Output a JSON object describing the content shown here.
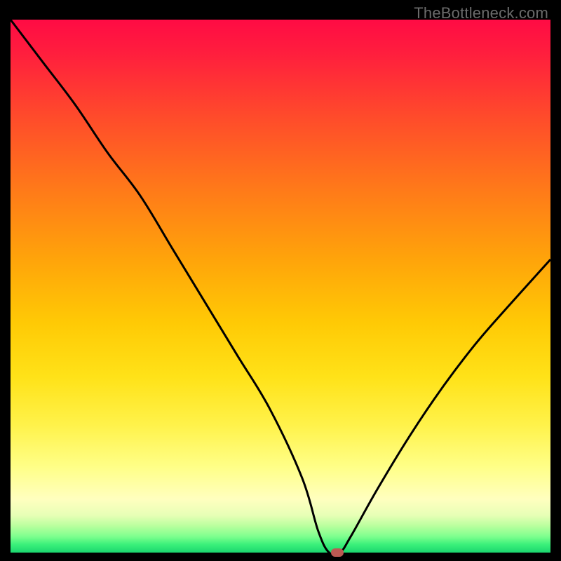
{
  "watermark": "TheBottleneck.com",
  "colors": {
    "curve_stroke": "#000000",
    "marker_fill": "#bc5a53"
  },
  "chart_data": {
    "type": "line",
    "title": "",
    "xlabel": "",
    "ylabel": "",
    "xlim": [
      0,
      100
    ],
    "ylim": [
      0,
      100
    ],
    "grid": false,
    "legend": false,
    "annotations": [
      {
        "kind": "marker",
        "x": 60.5,
        "y": 0,
        "shape": "pill"
      }
    ],
    "series": [
      {
        "name": "bottleneck-curve",
        "x": [
          0,
          6,
          12,
          18,
          24,
          30,
          36,
          42,
          48,
          54,
          57,
          59,
          61,
          63,
          68,
          74,
          80,
          86,
          92,
          100
        ],
        "y": [
          100,
          92,
          84,
          75,
          67,
          57,
          47,
          37,
          27,
          14,
          4,
          0,
          0,
          3,
          12,
          22,
          31,
          39,
          46,
          55
        ]
      }
    ]
  }
}
